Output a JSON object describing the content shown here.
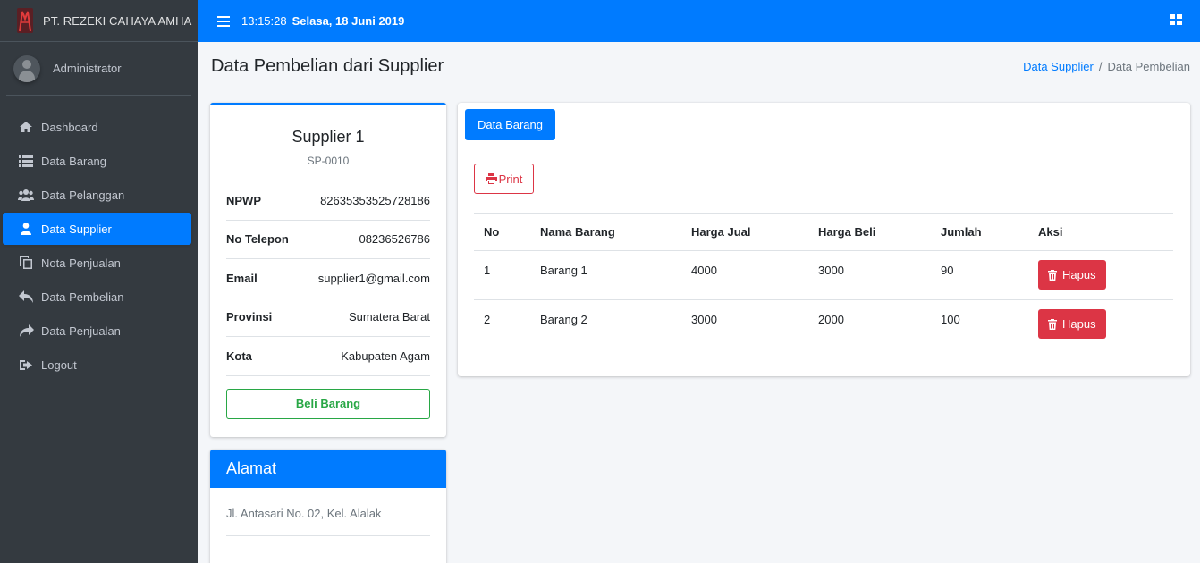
{
  "brand": {
    "name": "PT. REZEKI CAHAYA AMHA"
  },
  "user": {
    "name": "Administrator"
  },
  "sidebar": {
    "items": [
      {
        "label": "Dashboard",
        "icon": "home-icon",
        "active": false
      },
      {
        "label": "Data Barang",
        "icon": "list-icon",
        "active": false
      },
      {
        "label": "Data Pelanggan",
        "icon": "users-icon",
        "active": false
      },
      {
        "label": "Data Supplier",
        "icon": "user-icon",
        "active": true
      },
      {
        "label": "Nota Penjualan",
        "icon": "copy-icon",
        "active": false
      },
      {
        "label": "Data Pembelian",
        "icon": "reply-icon",
        "active": false
      },
      {
        "label": "Data Penjualan",
        "icon": "share-icon",
        "active": false
      },
      {
        "label": "Logout",
        "icon": "sign-out-icon",
        "active": false
      }
    ]
  },
  "topbar": {
    "time": "13:15:28",
    "date": "Selasa, 18 Juni 2019"
  },
  "header": {
    "title": "Data Pembelian dari Supplier",
    "breadcrumb": {
      "link": "Data Supplier",
      "separator": "/",
      "current": "Data Pembelian"
    }
  },
  "supplier": {
    "name": "Supplier 1",
    "code": "SP-0010",
    "fields": [
      {
        "label": "NPWP",
        "value": "82635353525728186"
      },
      {
        "label": "No Telepon",
        "value": "08236526786"
      },
      {
        "label": "Email",
        "value": "supplier1@gmail.com"
      },
      {
        "label": "Provinsi",
        "value": "Sumatera Barat"
      },
      {
        "label": "Kota",
        "value": "Kabupaten Agam"
      }
    ],
    "buy_label": "Beli Barang"
  },
  "alamat": {
    "title": "Alamat",
    "text": "Jl. Antasari No. 02, Kel. Alalak"
  },
  "main": {
    "tab_label": "Data Barang",
    "print_label": "Print",
    "columns": [
      "No",
      "Nama Barang",
      "Harga Jual",
      "Harga Beli",
      "Jumlah",
      "Aksi"
    ],
    "rows": [
      {
        "no": "1",
        "nama": "Barang 1",
        "jual": "4000",
        "beli": "3000",
        "jumlah": "90",
        "aksi": "Hapus"
      },
      {
        "no": "2",
        "nama": "Barang 2",
        "jual": "3000",
        "beli": "2000",
        "jumlah": "100",
        "aksi": "Hapus"
      }
    ]
  },
  "colors": {
    "primary": "#007bff",
    "danger": "#dc3545",
    "success": "#28a745",
    "sidebar": "#343a40"
  }
}
